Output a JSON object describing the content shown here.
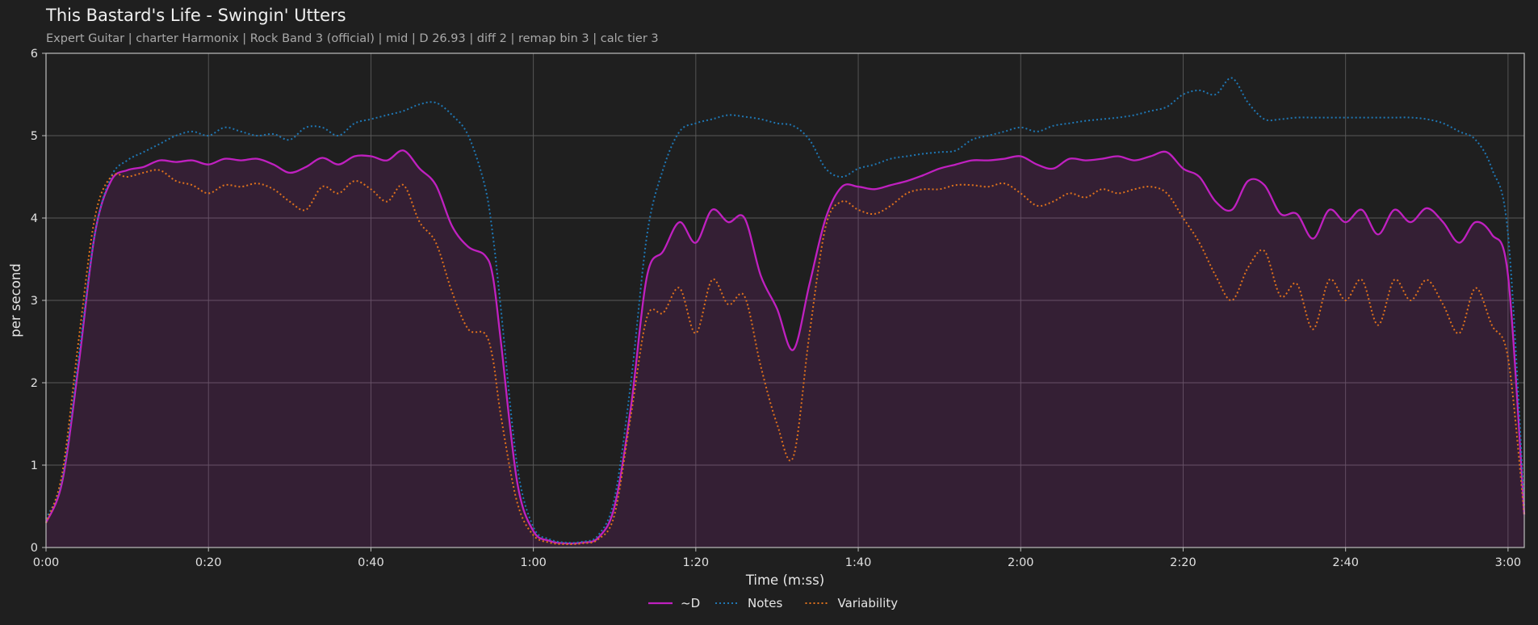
{
  "chart_data": {
    "type": "line",
    "title": "This Bastard's Life - Swingin' Utters",
    "subtitle": "Expert Guitar  |  charter Harmonix  |  Rock Band 3 (official)  |  mid  |  D 26.93  |  diff 2  |  remap bin 3  |  calc tier 3",
    "xlabel": "Time (m:ss)",
    "ylabel": "per second",
    "xlim": [
      0,
      182
    ],
    "ylim": [
      0,
      6
    ],
    "xticks": [
      0,
      20,
      40,
      60,
      80,
      100,
      120,
      140,
      160,
      180
    ],
    "xtick_labels": [
      "0:00",
      "0:20",
      "0:40",
      "1:00",
      "1:20",
      "1:40",
      "2:00",
      "2:20",
      "2:40",
      "3:00"
    ],
    "yticks": [
      0,
      1,
      2,
      3,
      4,
      5,
      6
    ],
    "ytick_labels": [
      "0",
      "1",
      "2",
      "3",
      "4",
      "5",
      "6"
    ],
    "grid": true,
    "legend_position": "bottom-center",
    "x": [
      0,
      2,
      4,
      6,
      8,
      10,
      12,
      14,
      16,
      18,
      20,
      22,
      24,
      26,
      28,
      30,
      32,
      34,
      36,
      38,
      40,
      42,
      44,
      46,
      48,
      50,
      52,
      54,
      55,
      56,
      58,
      60,
      62,
      64,
      66,
      68,
      70,
      72,
      74,
      76,
      78,
      80,
      82,
      84,
      86,
      88,
      90,
      92,
      94,
      96,
      98,
      100,
      102,
      104,
      106,
      108,
      110,
      112,
      114,
      116,
      118,
      120,
      122,
      124,
      126,
      128,
      130,
      132,
      134,
      136,
      138,
      140,
      142,
      144,
      146,
      148,
      150,
      152,
      154,
      156,
      158,
      160,
      162,
      164,
      166,
      168,
      170,
      172,
      174,
      176,
      178,
      180,
      182
    ],
    "series": [
      {
        "name": "~D",
        "color": "#c020c0",
        "style": "solid",
        "fill": true,
        "values": [
          0.3,
          0.8,
          2.2,
          3.8,
          4.45,
          4.58,
          4.62,
          4.7,
          4.68,
          4.7,
          4.65,
          4.72,
          4.7,
          4.72,
          4.65,
          4.55,
          4.62,
          4.73,
          4.65,
          4.75,
          4.75,
          4.7,
          4.82,
          4.6,
          4.4,
          3.9,
          3.65,
          3.55,
          3.3,
          2.5,
          0.8,
          0.2,
          0.08,
          0.05,
          0.06,
          0.12,
          0.5,
          1.7,
          3.3,
          3.6,
          3.95,
          3.7,
          4.1,
          3.95,
          4.0,
          3.3,
          2.9,
          2.4,
          3.2,
          4.0,
          4.38,
          4.38,
          4.35,
          4.4,
          4.45,
          4.52,
          4.6,
          4.65,
          4.7,
          4.7,
          4.72,
          4.75,
          4.65,
          4.6,
          4.72,
          4.7,
          4.72,
          4.75,
          4.7,
          4.75,
          4.8,
          4.6,
          4.5,
          4.2,
          4.1,
          4.45,
          4.4,
          4.05,
          4.05,
          3.75,
          4.1,
          3.95,
          4.1,
          3.8,
          4.1,
          3.95,
          4.12,
          3.95,
          3.7,
          3.95,
          3.8,
          3.3,
          0.4
        ]
      },
      {
        "name": "Notes",
        "color": "#1f77b4",
        "style": "dotted",
        "fill": false,
        "values": [
          0.35,
          0.85,
          2.3,
          3.8,
          4.5,
          4.7,
          4.8,
          4.9,
          5.0,
          5.05,
          5.0,
          5.1,
          5.05,
          5.0,
          5.02,
          4.95,
          5.1,
          5.1,
          5.0,
          5.15,
          5.2,
          5.25,
          5.3,
          5.38,
          5.4,
          5.25,
          5.0,
          4.4,
          3.8,
          2.9,
          1.0,
          0.25,
          0.1,
          0.06,
          0.07,
          0.15,
          0.6,
          2.0,
          3.8,
          4.6,
          5.05,
          5.15,
          5.2,
          5.25,
          5.23,
          5.2,
          5.15,
          5.12,
          4.95,
          4.6,
          4.5,
          4.6,
          4.65,
          4.72,
          4.75,
          4.78,
          4.8,
          4.82,
          4.95,
          5.0,
          5.05,
          5.1,
          5.05,
          5.12,
          5.15,
          5.18,
          5.2,
          5.22,
          5.25,
          5.3,
          5.35,
          5.5,
          5.55,
          5.5,
          5.7,
          5.4,
          5.2,
          5.2,
          5.22,
          5.22,
          5.22,
          5.22,
          5.22,
          5.22,
          5.22,
          5.22,
          5.2,
          5.15,
          5.05,
          4.95,
          4.6,
          3.8,
          0.5
        ]
      },
      {
        "name": "Variability",
        "color": "#e0721c",
        "style": "dotted",
        "fill": false,
        "values": [
          0.3,
          0.9,
          2.5,
          4.0,
          4.5,
          4.5,
          4.55,
          4.58,
          4.45,
          4.4,
          4.3,
          4.4,
          4.38,
          4.42,
          4.35,
          4.2,
          4.1,
          4.38,
          4.3,
          4.45,
          4.35,
          4.2,
          4.4,
          3.95,
          3.7,
          3.1,
          2.65,
          2.6,
          2.3,
          1.6,
          0.55,
          0.15,
          0.06,
          0.04,
          0.05,
          0.1,
          0.4,
          1.6,
          2.8,
          2.85,
          3.15,
          2.6,
          3.25,
          2.95,
          3.05,
          2.2,
          1.5,
          1.1,
          2.6,
          3.9,
          4.2,
          4.1,
          4.05,
          4.15,
          4.3,
          4.35,
          4.35,
          4.4,
          4.4,
          4.38,
          4.42,
          4.3,
          4.15,
          4.2,
          4.3,
          4.25,
          4.35,
          4.3,
          4.35,
          4.38,
          4.3,
          4.0,
          3.7,
          3.3,
          3.0,
          3.4,
          3.6,
          3.05,
          3.2,
          2.65,
          3.25,
          3.0,
          3.25,
          2.7,
          3.25,
          3.0,
          3.25,
          2.95,
          2.6,
          3.15,
          2.7,
          2.3,
          0.4
        ]
      }
    ]
  }
}
